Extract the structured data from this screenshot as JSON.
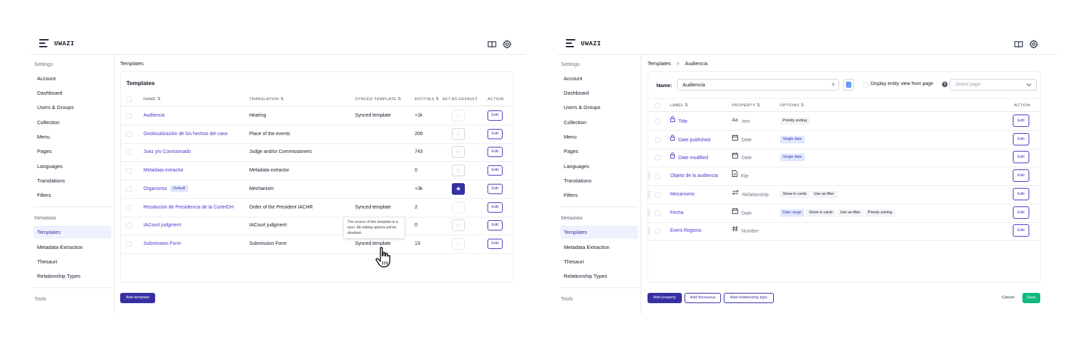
{
  "left": {
    "app": {
      "logo": "UWAZI",
      "menu_icon": "menu-icon",
      "book_icon": "book-icon",
      "settings_icon": "gear-icon"
    },
    "sidebar": {
      "settings_header": "Settings",
      "items": [
        "Account",
        "Dashboard",
        "Users & Groups",
        "Collection",
        "Menu",
        "Pages",
        "Languages",
        "Translations",
        "Filters"
      ],
      "metadata_header": "Metadata",
      "metadata_items": [
        "Templates",
        "Metadata Extraction",
        "Thesauri",
        "Relationship Types"
      ],
      "active": "Templates",
      "tools_header": "Tools"
    },
    "breadcrumb": "Templates",
    "card_title": "Templates",
    "columns": [
      "NAME",
      "TRANSLATION",
      "SYNCED TEMPLATE",
      "ENTITIES",
      "SET AS DEFAULT",
      "ACTION"
    ],
    "rows": [
      {
        "name": "Audiencia",
        "translation": "Hearing",
        "synced": "Synced template",
        "entities": "+1k",
        "default": false,
        "badge": "",
        "edit": "Edit"
      },
      {
        "name": "Geolocalización de los hechos del caso",
        "translation": "Place of the events",
        "synced": "",
        "entities": "200",
        "default": false,
        "badge": "",
        "edit": "Edit"
      },
      {
        "name": "Juez y/o Comisionado",
        "translation": "Judge and/or Commissioners",
        "synced": "",
        "entities": "743",
        "default": false,
        "badge": "",
        "edit": "Edit"
      },
      {
        "name": "Metadata extractor",
        "translation": "Metadata extractor",
        "synced": "",
        "entities": "0",
        "default": false,
        "badge": "",
        "edit": "Edit"
      },
      {
        "name": "Organismo",
        "translation": "Mechanism",
        "synced": "",
        "entities": "+3k",
        "default": true,
        "badge": "Default",
        "edit": "Edit"
      },
      {
        "name": "Resolución de Presidencia de la CorteIDH",
        "translation": "Order of the President IACHR",
        "synced": "Synced template",
        "entities": "2",
        "default": false,
        "badge": "",
        "edit": "Edit"
      },
      {
        "name": "IACourt judgment",
        "translation": "IACourt judgment",
        "synced": "",
        "entities": "0",
        "default": false,
        "badge": "",
        "edit": "Edit"
      },
      {
        "name": "Submission Form",
        "translation": "Submission Form",
        "synced": "Synced template",
        "entities": "13",
        "default": false,
        "badge": "",
        "edit": "Edit"
      }
    ],
    "tooltip": "The source of this template is a sync. All editing options will be disabled.",
    "add_button": "Add template"
  },
  "right": {
    "app": {
      "logo": "UWAZI",
      "menu_icon": "menu-icon",
      "book_icon": "book-icon",
      "settings_icon": "gear-icon"
    },
    "sidebar": {
      "settings_header": "Settings",
      "items": [
        "Account",
        "Dashboard",
        "Users & Groups",
        "Collection",
        "Menu",
        "Pages",
        "Languages",
        "Translations",
        "Filters"
      ],
      "metadata_header": "Metadata",
      "metadata_items": [
        "Templates",
        "Metadata Extraction",
        "Thesauri",
        "Relationship Types"
      ],
      "active": "Templates",
      "tools_header": "Tools"
    },
    "breadcrumb": {
      "parent": "Templates",
      "separator": ">",
      "current": "Audiencia"
    },
    "form": {
      "name_label": "Name:",
      "name_value": "Audiencia",
      "clear": "×",
      "color": "#6b9cf5",
      "display_label": "Display entity view from page",
      "select_placeholder": "Select page"
    },
    "columns": [
      "LABEL",
      "PROPERTY",
      "OPTIONS",
      "ACTION"
    ],
    "properties": [
      {
        "label": "Title",
        "locked": true,
        "icon": "text-icon",
        "type": "text",
        "options": [
          {
            "t": "Priority sorting",
            "blue": false
          }
        ],
        "edit": "Edit"
      },
      {
        "label": "Date published",
        "locked": true,
        "icon": "calendar-icon",
        "type": "Date",
        "options": [
          {
            "t": "Single date",
            "blue": true
          }
        ],
        "edit": "Edit"
      },
      {
        "label": "Date modified",
        "locked": true,
        "icon": "calendar-icon",
        "type": "Date",
        "options": [
          {
            "t": "Single date",
            "blue": true
          }
        ],
        "edit": "Edit"
      },
      {
        "label": "Objeto de la audiencia",
        "locked": false,
        "icon": "file-icon",
        "type": "File",
        "options": [],
        "edit": "Edit"
      },
      {
        "label": "Mecanismo",
        "locked": false,
        "icon": "relationship-icon",
        "type": "Relationship",
        "options": [
          {
            "t": "Show in cards",
            "blue": false
          },
          {
            "t": "Use as filter",
            "blue": false
          }
        ],
        "edit": "Edit"
      },
      {
        "label": "Fecha",
        "locked": false,
        "icon": "calendar-icon",
        "type": "Date",
        "options": [
          {
            "t": "Date range",
            "blue": true
          },
          {
            "t": "Show in cards",
            "blue": false
          },
          {
            "t": "Use as filter",
            "blue": false
          },
          {
            "t": "Priority sorting",
            "blue": false
          }
        ],
        "edit": "Edit"
      },
      {
        "label": "Event Regions",
        "locked": false,
        "icon": "hash-icon",
        "type": "Number",
        "options": [],
        "edit": "Edit"
      }
    ],
    "buttons": {
      "add_property": "Add property",
      "add_thesaurus": "Add thesaurus",
      "add_relationship": "Add relationship type",
      "cancel": "Cancel",
      "save": "Save"
    }
  }
}
